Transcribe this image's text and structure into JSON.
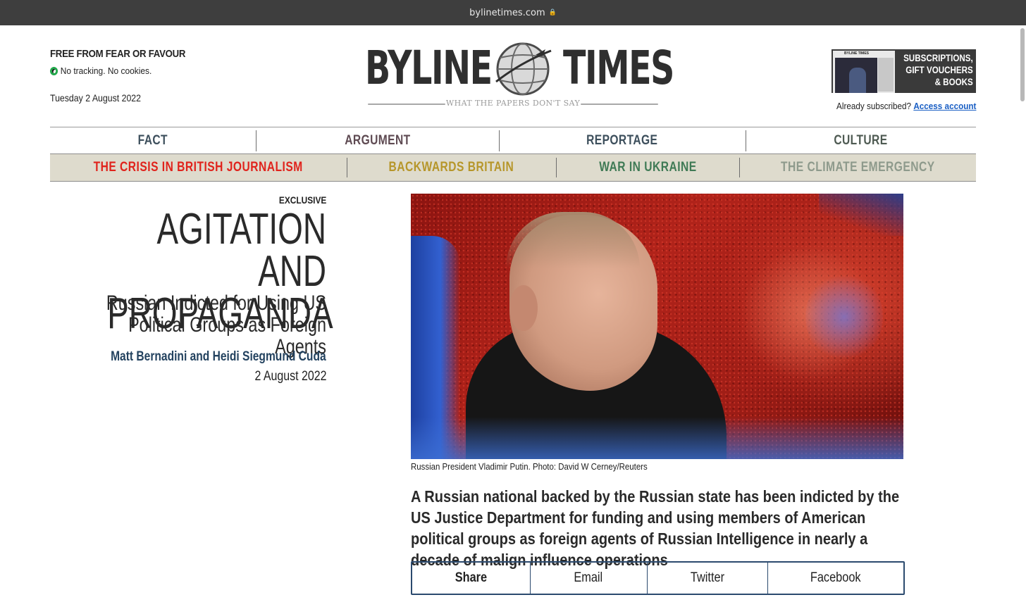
{
  "browser": {
    "url": "bylinetimes.com"
  },
  "header": {
    "tagline": "FREE FROM FEAR OR FAVOUR",
    "tracking": "No tracking. No cookies.",
    "date": "Tuesday 2 August 2022",
    "logo": {
      "left": "BYLINE",
      "right": "TIMES",
      "sub": "WHAT THE PAPERS DON'T SAY"
    },
    "promo": {
      "line1": "SUBSCRIPTIONS,",
      "line2": "GIFT VOUCHERS",
      "line3": "& BOOKS",
      "thumb_mast": "BYLINE TIMES"
    },
    "subscribed_text": "Already subscribed?",
    "access_link": "Access account"
  },
  "nav": [
    {
      "label": "FACT",
      "color": "#3d4f5c"
    },
    {
      "label": "ARGUMENT",
      "color": "#5e4a52"
    },
    {
      "label": "REPORTAGE",
      "color": "#3d4f5c"
    },
    {
      "label": "CULTURE",
      "color": "#4e5a52"
    }
  ],
  "subnav": [
    {
      "label": "THE CRISIS IN BRITISH JOURNALISM",
      "color": "#e0231c"
    },
    {
      "label": "BACKWARDS BRITAIN",
      "color": "#b6962a"
    },
    {
      "label": "WAR IN UKRAINE",
      "color": "#3f7a55"
    },
    {
      "label": "THE CLIMATE EMERGENCY",
      "color": "#8e9a8c"
    }
  ],
  "article": {
    "kicker": "EXCLUSIVE",
    "headline_line1": "AGITATION AND",
    "headline_line2": "PROPAGANDA",
    "subhead_line1": "Russian Indicted for Using US",
    "subhead_line2": "Political Groups as Foreign Agents",
    "authors": "Matt Bernadini and Heidi Siegmund Cuda",
    "date": "2 August 2022",
    "caption": "Russian President Vladimir Putin. Photo: David W Cerney/Reuters",
    "standfirst": "A Russian national backed by the Russian state has been indicted by the US Justice Department for funding and using members of American political groups as foreign agents of Russian Intelligence in nearly a decade of malign influence operations"
  },
  "share": [
    {
      "label": "Share"
    },
    {
      "label": "Email"
    },
    {
      "label": "Twitter"
    },
    {
      "label": "Facebook"
    }
  ]
}
